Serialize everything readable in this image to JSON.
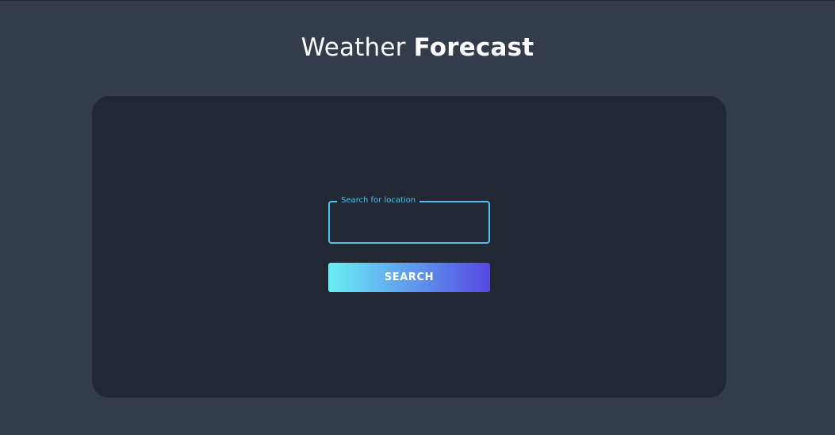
{
  "header": {
    "title_light": "Weather ",
    "title_bold": "Forecast"
  },
  "search": {
    "label": "Search for location",
    "value": "",
    "button_label": "SEARCH"
  },
  "colors": {
    "page_background": "#343c4b",
    "card_background": "#222833",
    "accent": "#4fc2f0",
    "button_gradient_start": "#6aeef4",
    "button_gradient_end": "#5648e2"
  }
}
